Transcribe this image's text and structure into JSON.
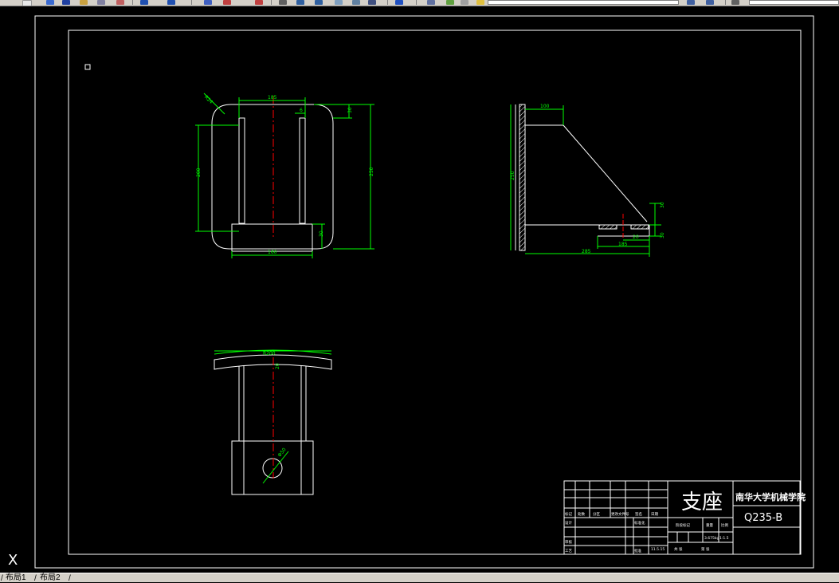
{
  "colors": {
    "background": "#000000",
    "geometry": "#ffffff",
    "dimensions": "#00ff00",
    "centerline": "#ff0000"
  },
  "toolbar": {
    "icons": [
      "new-icon",
      "open-icon",
      "save-icon",
      "print-icon",
      "cut-icon",
      "copy-icon",
      "paste-icon",
      "undo-icon",
      "redo-icon",
      "pan-icon",
      "zoom-icon",
      "properties-icon",
      "layer-icon"
    ]
  },
  "front_view": {
    "dims": {
      "width_top": "185",
      "radius": "R24",
      "slot": "6",
      "top_edge": "30",
      "inner_height": "200",
      "total_height": "250",
      "base_height": "30",
      "base_width": "160"
    }
  },
  "side_view": {
    "dims": {
      "top_width": "100",
      "height": "250",
      "right_height": "30",
      "rib": "20",
      "foot_height": "30",
      "inner_width": "185",
      "total_width": "285"
    }
  },
  "top_view": {
    "dims": {
      "arc_radius": "R200",
      "slot": "20",
      "hole": "Φ50"
    }
  },
  "title_block": {
    "part_name": "支座",
    "institution": "南华大学机械学院",
    "material": "Q235-B",
    "small_labels": {
      "biaoji": "标记",
      "chushu": "处数",
      "fenqu": "分区",
      "gengai": "更改文件号",
      "qianming": "签名",
      "riqi": "日期",
      "sheji": "设计",
      "shenhe": "审核",
      "gongyi": "工艺",
      "biaozhunhua": "标准化",
      "pizhun": "批准",
      "jieduan": "阶段标记",
      "zhongliang": "重量",
      "bili": "比例",
      "weight_value": "3.675kg",
      "scale_value": "1:1.5",
      "gong": "共 张",
      "di": "第 张",
      "date_value": "11.5.15"
    }
  },
  "ucs": {
    "axis_label": "X"
  },
  "layout_tabs": {
    "tab1": "布局1",
    "tab2": "布局2"
  }
}
